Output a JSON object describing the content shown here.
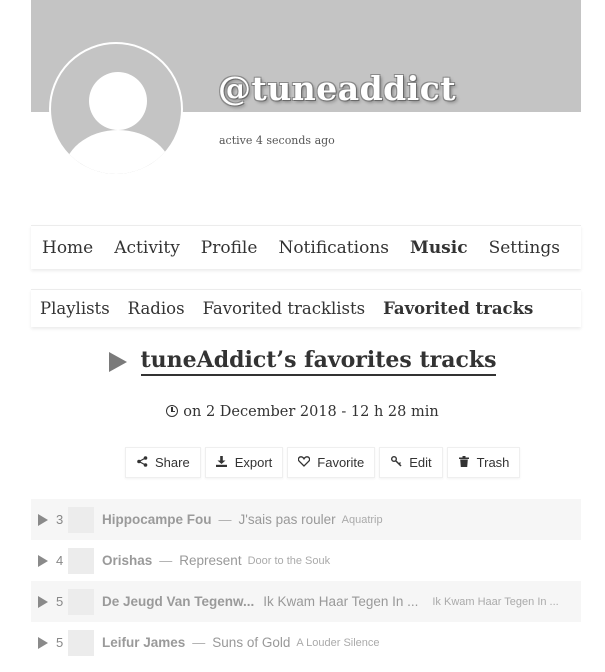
{
  "profile": {
    "username": "@tuneaddict",
    "active_status": "active 4 seconds ago"
  },
  "nav": {
    "items": [
      "Home",
      "Activity",
      "Profile",
      "Notifications",
      "Music",
      "Settings"
    ],
    "current": "Music"
  },
  "subnav": {
    "items": [
      "Playlists",
      "Radios",
      "Favorited tracklists",
      "Favorited tracks"
    ],
    "current": "Favorited tracks"
  },
  "tracklist": {
    "title": "tuneAddict’s favorites tracks",
    "date": "on 2 December 2018 - 12 h 28 min"
  },
  "actions": {
    "share": "Share",
    "export": "Export",
    "favorite": "Favorite",
    "edit": "Edit",
    "trash": "Trash"
  },
  "tracks": [
    {
      "num": "3",
      "artist": "Hippocampe Fou",
      "title": "J'sais pas rouler",
      "album": "Aquatrip"
    },
    {
      "num": "4",
      "artist": "Orishas",
      "title": "Represent",
      "album": "Door to the Souk"
    },
    {
      "num": "5",
      "artist": "De Jeugd Van Tegenw...",
      "title": "Ik Kwam Haar Tegen In ...",
      "album": "Ik Kwam Haar Tegen In ..."
    },
    {
      "num": "5",
      "artist": "Leifur James",
      "title": "Suns of Gold",
      "album": "A Louder Silence"
    }
  ],
  "icons": {
    "share": "share-icon",
    "export": "download-icon",
    "favorite": "heart-icon",
    "edit": "key-icon",
    "trash": "trash-icon"
  }
}
